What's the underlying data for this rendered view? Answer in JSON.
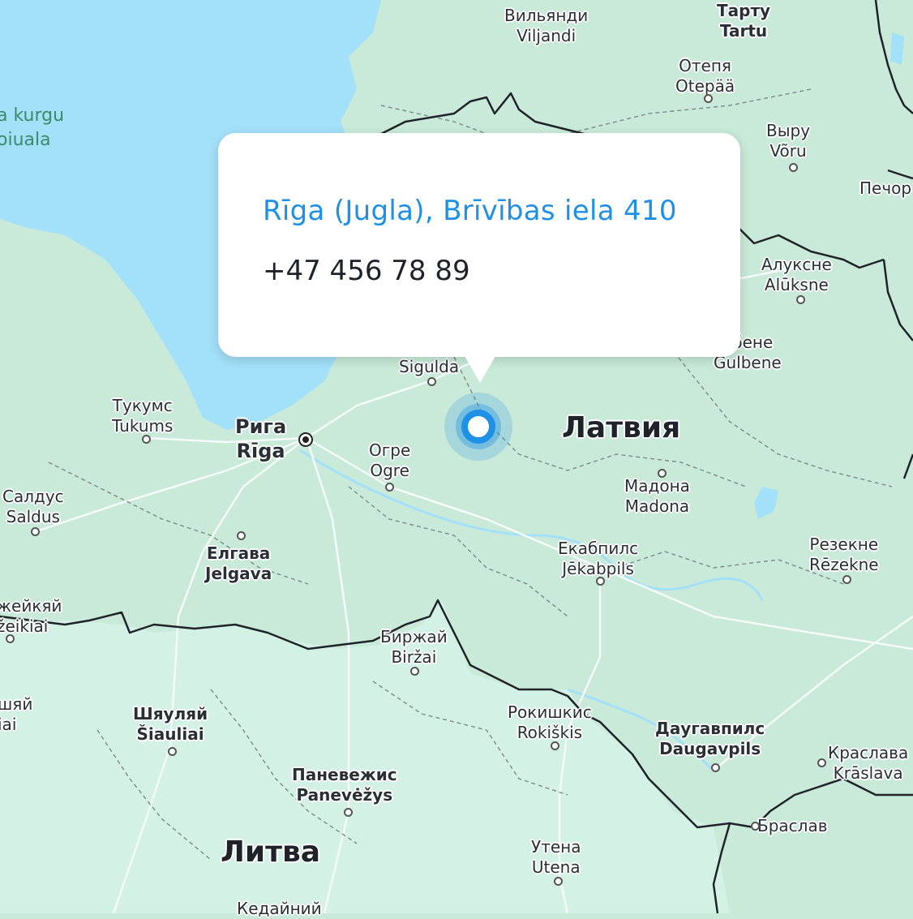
{
  "popup": {
    "title": "Rīga (Jugla), Brīvības iela 410",
    "phone": "+47 456 78 89"
  },
  "colors": {
    "water": "#a3e0f9",
    "land": "#c9ead8",
    "land_light": "#d8f4ee",
    "border": "#1f2329",
    "accent": "#1e90e6"
  },
  "labels": {
    "water": {
      "l1": "a kurgu",
      "l2": "oiuala"
    },
    "viljandi": {
      "ru": "Вильянди",
      "local": "Viljandi"
    },
    "tartu": {
      "ru": "Тарту",
      "local": "Tartu"
    },
    "otepaa": {
      "ru": "Отепя",
      "local": "Otepää"
    },
    "voru": {
      "ru": "Выру",
      "local": "Võru"
    },
    "pechory": {
      "ru": "Печор"
    },
    "aluksne": {
      "ru": "Алуксне",
      "local": "Alūksne"
    },
    "gulbene": {
      "ru": "лбене",
      "local": "Gulbene"
    },
    "sigulda": {
      "local": "Sigulda"
    },
    "tukums": {
      "ru": "Тукумс",
      "local": "Tukums"
    },
    "riga": {
      "ru": "Рига",
      "local": "Rīga"
    },
    "ogre": {
      "ru": "Огре",
      "local": "Ogre"
    },
    "latvia": {
      "ru": "Латвия"
    },
    "madona": {
      "ru": "Мадона",
      "local": "Madona"
    },
    "saldus": {
      "ru": "Салдус",
      "local": "Saldus"
    },
    "jelgava": {
      "ru": "Елгава",
      "local": "Jelgava"
    },
    "jekabpils": {
      "ru": "Екабпилс",
      "local": "Jēkabpils"
    },
    "rezekne": {
      "ru": "Резекне",
      "local": "Rēzekne"
    },
    "mazeikiai": {
      "ru": "жейкяй",
      "local": "žeikiai"
    },
    "birzai": {
      "ru": "Биржай",
      "local": "Biržai"
    },
    "siauliai_partial": {
      "ru": "шяй",
      "local": "iai"
    },
    "siauliai": {
      "ru": "Шяуляй",
      "local": "Šiauliai"
    },
    "rokiskis": {
      "ru": "Рокишкис",
      "local": "Rokiškis"
    },
    "daugavpils": {
      "ru": "Даугавпилс",
      "local": "Daugavpils"
    },
    "kraslava": {
      "ru": "Краслава",
      "local": "Krāslava"
    },
    "panevezys": {
      "ru": "Паневежис",
      "local": "Panevėžys"
    },
    "braslav": {
      "ru": "Браслав"
    },
    "lithuania": {
      "ru": "Литва"
    },
    "utena": {
      "ru": "Утена",
      "local": "Utena"
    },
    "kedainiai": {
      "ru": "Кедайний"
    }
  }
}
